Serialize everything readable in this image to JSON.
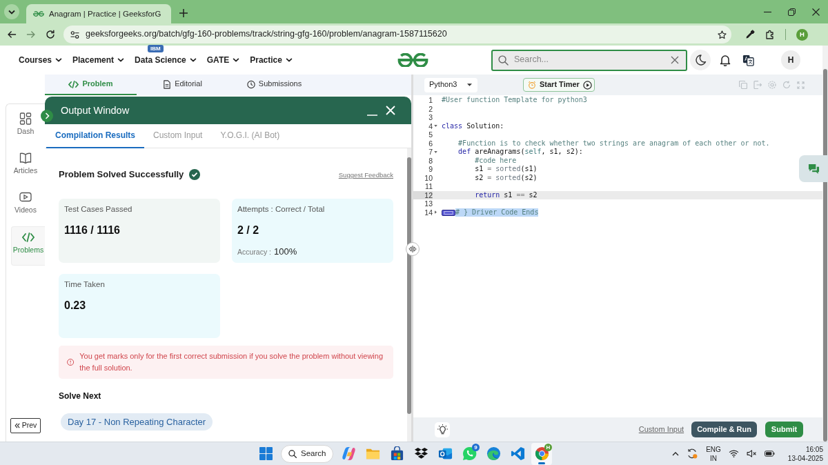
{
  "browser": {
    "tab_title": "Anagram | Practice | GeeksforG",
    "url": "geeksforgeeks.org/batch/gfg-160-problems/track/string-gfg-160/problem/anagram-1587115620",
    "profile": "H"
  },
  "site_nav": {
    "items": [
      {
        "label": "Courses"
      },
      {
        "label": "Placement"
      },
      {
        "label": "Data Science",
        "badge": "IBM"
      },
      {
        "label": "GATE"
      },
      {
        "label": "Practice"
      }
    ],
    "search": {
      "placeholder": "Search..."
    },
    "avatar": "H"
  },
  "sidebar": {
    "items": [
      {
        "label": "Dash",
        "selected": false
      },
      {
        "label": "Articles",
        "selected": false
      },
      {
        "label": "Videos",
        "selected": false
      },
      {
        "label": "Problems",
        "selected": true
      }
    ],
    "prev_button": "Prev"
  },
  "problem_tabs": [
    {
      "label": "Problem",
      "selected": true
    },
    {
      "label": "Editorial",
      "selected": false
    },
    {
      "label": "Submissions",
      "selected": false
    }
  ],
  "output_window": {
    "title": "Output Window",
    "tabs": [
      {
        "label": "Compilation Results",
        "selected": true
      },
      {
        "label": "Custom Input",
        "selected": false
      },
      {
        "label": "Y.O.G.I. (AI Bot)",
        "selected": false
      }
    ],
    "status": "Problem Solved Successfully",
    "feedback_link": "Suggest Feedback",
    "stats": [
      {
        "label": "Test Cases Passed",
        "value": "1116 / 1116",
        "color": "#f1f6f4"
      },
      {
        "label": "Attempts : Correct / Total",
        "value": "2 / 2",
        "detail_label": "Accuracy :",
        "detail_value": "100%",
        "color": "#ebfafd"
      },
      {
        "label": "Time Taken",
        "value": "0.23",
        "color": "#ebfafd"
      }
    ],
    "notice": "You get marks only for the first correct submission if you solve the problem without viewing the full solution.",
    "solve_next": {
      "heading": "Solve Next",
      "items": [
        "Day 17 - Non Repeating Character"
      ]
    }
  },
  "editor": {
    "language": "Python3",
    "timer_button": "Start Timer",
    "lines": [
      {
        "number": "1",
        "tokens": [
          {
            "text": "#User function Template for python3",
            "kind": "comment"
          }
        ],
        "active": false,
        "text_selected": false
      },
      {
        "number": "2",
        "active": false,
        "text_selected": false
      },
      {
        "number": "3",
        "active": false,
        "text_selected": false
      },
      {
        "number": "4",
        "expanded": true,
        "tokens": [
          {
            "text": "class",
            "kind": "keyword"
          },
          {
            "text": " Solution:",
            "kind": "plain"
          }
        ],
        "active": false,
        "text_selected": false
      },
      {
        "number": "5",
        "active": false,
        "text_selected": false
      },
      {
        "number": "6",
        "tokens": [
          {
            "text": "    #Function is to check whether two strings are anagram of each other or not.",
            "kind": "comment"
          }
        ],
        "active": false,
        "text_selected": false
      },
      {
        "number": "7",
        "expanded": true,
        "tokens": [
          {
            "text": "    def",
            "kind": "keyword"
          },
          {
            "text": " areAnagrams(",
            "kind": "plain"
          },
          {
            "text": "self",
            "kind": "variable"
          },
          {
            "text": ", s1, s2):",
            "kind": "plain"
          }
        ],
        "active": false,
        "text_selected": false
      },
      {
        "number": "8",
        "tokens": [
          {
            "text": "        #code here",
            "kind": "comment"
          }
        ],
        "active": false,
        "text_selected": false
      },
      {
        "number": "9",
        "tokens": [
          {
            "text": "        s1 ",
            "kind": "plain"
          },
          {
            "text": "=",
            "kind": "operator"
          },
          {
            "text": " sorted",
            "kind": "function"
          },
          {
            "text": "(s1)",
            "kind": "plain"
          }
        ],
        "active": false,
        "text_selected": false
      },
      {
        "number": "10",
        "tokens": [
          {
            "text": "        s2 ",
            "kind": "plain"
          },
          {
            "text": "=",
            "kind": "operator"
          },
          {
            "text": " sorted",
            "kind": "function"
          },
          {
            "text": "(s2)",
            "kind": "plain"
          }
        ],
        "active": false,
        "text_selected": false
      },
      {
        "number": "11",
        "active": false,
        "text_selected": false
      },
      {
        "number": "12",
        "tokens": [
          {
            "text": "        return",
            "kind": "keyword"
          },
          {
            "text": " s1 ",
            "kind": "plain"
          },
          {
            "text": "==",
            "kind": "operator"
          },
          {
            "text": " s2",
            "kind": "plain"
          }
        ],
        "active": true,
        "text_selected": false
      },
      {
        "number": "13",
        "active": false,
        "text_selected": false
      },
      {
        "number": "14",
        "expanded": false,
        "tokens": [
          {
            "text": "# } Driver Code Ends",
            "kind": "comment"
          }
        ],
        "active": false,
        "text_selected": true
      }
    ],
    "custom_input_link": "Custom Input",
    "buttons": [
      {
        "label": "Compile & Run",
        "kind": "secondary"
      },
      {
        "label": "Submit",
        "kind": "primary"
      }
    ]
  },
  "taskbar": {
    "search": "Search",
    "apps": [
      {
        "active": false
      },
      {
        "active": false
      },
      {
        "active": false
      },
      {
        "active": false
      },
      {
        "active": false
      },
      {
        "active": false,
        "badge": "9"
      },
      {
        "active": false
      },
      {
        "active": false
      },
      {
        "active": true,
        "badge": "H"
      }
    ],
    "language": "ENG",
    "region": "IN",
    "time": "16:05",
    "date": "13-04-2025"
  }
}
